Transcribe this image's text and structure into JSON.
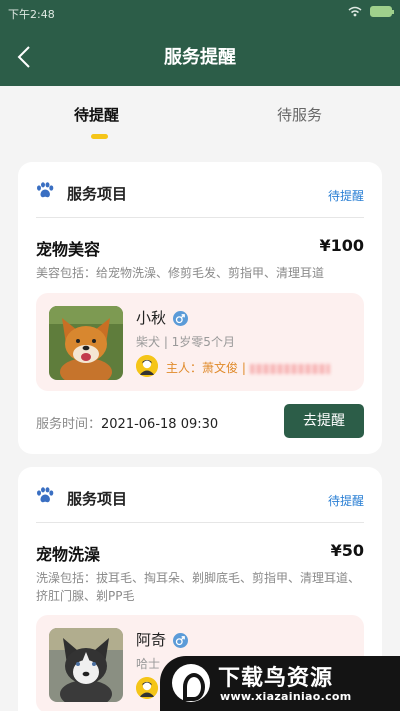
{
  "status_bar": {
    "time": "下午2:48"
  },
  "nav": {
    "title": "服务提醒"
  },
  "tabs": [
    {
      "label": "待提醒"
    },
    {
      "label": "待服务"
    }
  ],
  "cards": [
    {
      "header_title": "服务项目",
      "status": "待提醒",
      "service_name": "宠物美容",
      "price": "¥100",
      "description": "美容包括：给宠物洗澡、修剪毛发、剪指甲、清理耳道",
      "pet": {
        "name": "小秋",
        "info": "柴犬 | 1岁零5个月",
        "owner": "主人：萧文俊 |"
      },
      "time_label": "服务时间：",
      "time_value": "2021-06-18 09:30",
      "button": "去提醒"
    },
    {
      "header_title": "服务项目",
      "status": "待提醒",
      "service_name": "宠物洗澡",
      "price": "¥50",
      "description": "洗澡包括：拔耳毛、掏耳朵、剃脚底毛、剪指甲、清理耳道、挤肛门腺、剃PP毛",
      "pet": {
        "name": "阿奇",
        "info": "哈士"
      }
    }
  ],
  "watermark": {
    "title": "下载鸟资源",
    "url": "www.xiazainiao.com"
  },
  "colors": {
    "primary": "#2c5d48",
    "accent": "#f5c518",
    "link": "#2a7fd4",
    "pet_bg": "#fdf0ef",
    "owner": "#e08a2a"
  }
}
